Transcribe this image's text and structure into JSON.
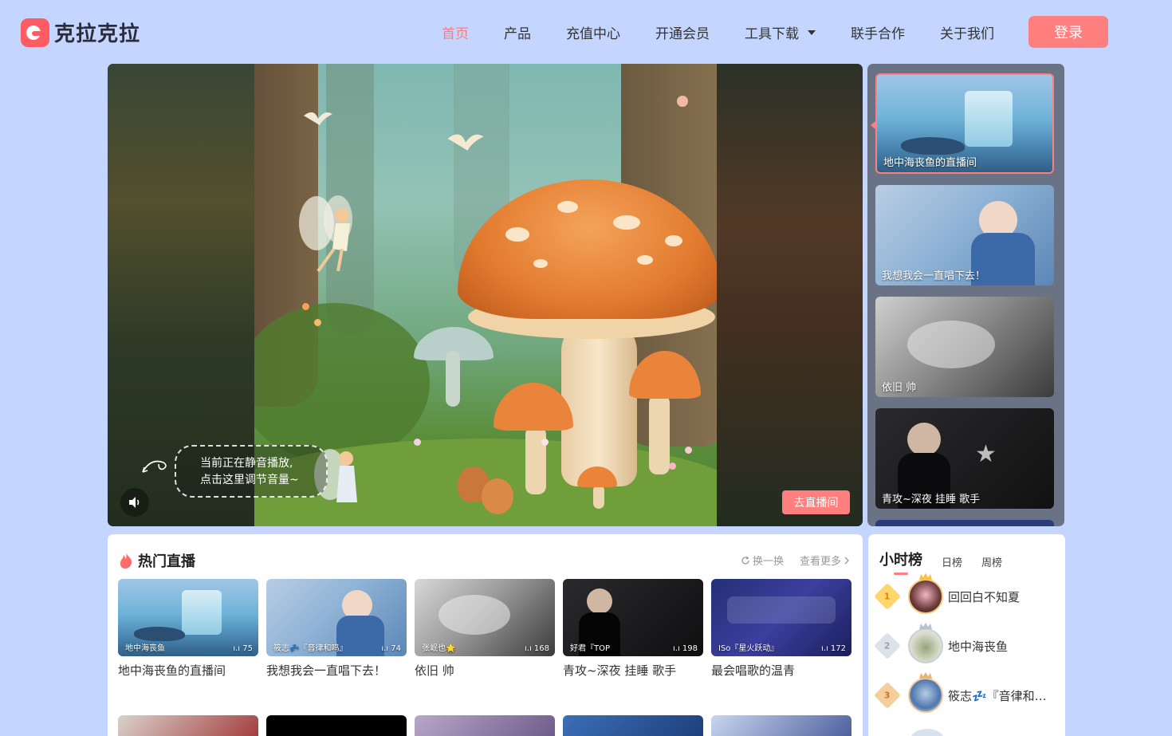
{
  "brand": {
    "name": "克拉克拉"
  },
  "nav": {
    "items": [
      {
        "label": "首页",
        "active": true
      },
      {
        "label": "产品"
      },
      {
        "label": "充值中心"
      },
      {
        "label": "开通会员"
      },
      {
        "label": "工具下载",
        "has_dropdown": true
      },
      {
        "label": "联手合作"
      },
      {
        "label": "关于我们"
      }
    ],
    "login_label": "登录"
  },
  "player": {
    "mute_hint_line1": "当前正在静音播放,",
    "mute_hint_line2": "点击这里调节音量~",
    "go_live_label": "去直播间"
  },
  "carousel": [
    {
      "label": "地中海丧鱼的直播间",
      "active": true
    },
    {
      "label": "我想我会一直唱下去！"
    },
    {
      "label": "依旧 帅"
    },
    {
      "label": "青攻~深夜 挂睡 歌手"
    }
  ],
  "hot": {
    "title": "热门直播",
    "refresh_label": "换一换",
    "more_label": "查看更多",
    "cards": [
      {
        "title": "地中海丧鱼的直播间",
        "anchor": "地中海丧鱼",
        "viewers": "75"
      },
      {
        "title": "我想我会一直唱下去！",
        "anchor": "筱志💤『音律和鸣』",
        "viewers": "74"
      },
      {
        "title": "依旧 帅",
        "anchor": "张岷也🌟",
        "viewers": "168"
      },
      {
        "title": "青攻~深夜 挂睡 歌手",
        "anchor": "好君『TOP",
        "viewers": "198"
      },
      {
        "title": "最会唱歌的温青",
        "anchor": "ISo『星火跃动』",
        "viewers": "172"
      }
    ]
  },
  "rank": {
    "tabs": [
      {
        "label": "小时榜",
        "active": true
      },
      {
        "label": "日榜"
      },
      {
        "label": "周榜"
      }
    ],
    "items": [
      {
        "rank": "1",
        "name": "回回白不知夏"
      },
      {
        "rank": "2",
        "name": "地中海丧鱼"
      },
      {
        "rank": "3",
        "name": "筱志💤『音律和…"
      }
    ]
  },
  "colors": {
    "background": "#c4d6ff",
    "accent": "#ff7e7e",
    "nav_active": "#ff7b7b",
    "carousel_bg": "#6a7386"
  },
  "icons": [
    "logo-icon",
    "caret-down-icon",
    "volume-icon",
    "fire-icon",
    "refresh-icon",
    "chevron-right-icon",
    "signal-icon",
    "rank-diamond-icon",
    "crown-icon"
  ]
}
